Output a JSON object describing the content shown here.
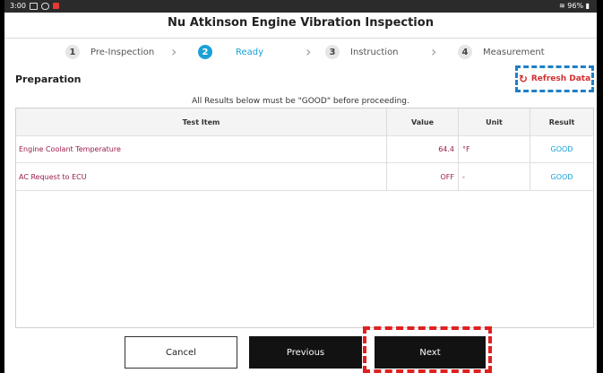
{
  "status_bar": {
    "time": "3:00",
    "battery": "96%"
  },
  "header": {
    "title": "Nu Atkinson Engine Vibration Inspection"
  },
  "steps": [
    {
      "num": "1",
      "label": "Pre-Inspection"
    },
    {
      "num": "2",
      "label": "Ready"
    },
    {
      "num": "3",
      "label": "Instruction"
    },
    {
      "num": "4",
      "label": "Measurement"
    }
  ],
  "section": {
    "title": "Preparation",
    "refresh_label": "Refresh Data"
  },
  "notice": "All Results below must be \"GOOD\" before proceeding.",
  "table": {
    "headers": {
      "item": "Test Item",
      "value": "Value",
      "unit": "Unit",
      "result": "Result"
    },
    "rows": [
      {
        "item": "Engine Coolant Temperature",
        "value": "64.4",
        "unit": "°F",
        "result": "GOOD"
      },
      {
        "item": "AC Request to ECU",
        "value": "OFF",
        "unit": "-",
        "result": "GOOD"
      }
    ]
  },
  "buttons": {
    "cancel": "Cancel",
    "previous": "Previous",
    "next": "Next"
  },
  "colors": {
    "accent": "#1aa1d6",
    "value_text": "#9c1b4e",
    "highlight_blue": "#1e7fc9",
    "highlight_red": "#e02020"
  }
}
